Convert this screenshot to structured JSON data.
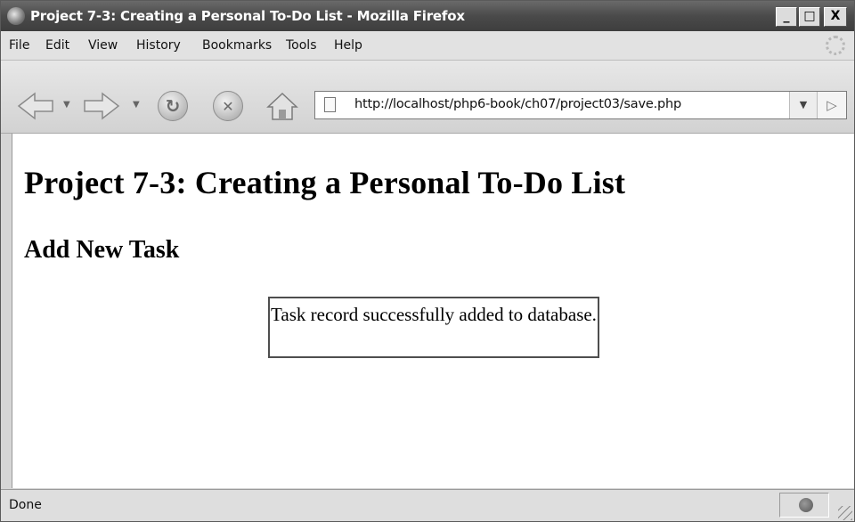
{
  "window": {
    "title": "Project 7-3: Creating a Personal To-Do List - Mozilla Firefox",
    "controls": {
      "minimize": "_",
      "maximize": "□",
      "close": "X"
    }
  },
  "menubar": {
    "items": [
      {
        "label": "File"
      },
      {
        "label": "Edit"
      },
      {
        "label": "View"
      },
      {
        "label": "History"
      },
      {
        "label": "Bookmarks"
      },
      {
        "label": "Tools"
      },
      {
        "label": "Help"
      }
    ]
  },
  "navbar": {
    "icons": [
      "back-arrow-icon",
      "forward-arrow-icon",
      "reload-icon",
      "stop-icon",
      "home-icon"
    ],
    "url": "http://localhost/php6-book/ch07/project03/save.php"
  },
  "page": {
    "heading": "Project 7-3: Creating a Personal To-Do List",
    "subheading": "Add New Task",
    "message": "Task record successfully added to database."
  },
  "statusbar": {
    "text": "Done"
  }
}
